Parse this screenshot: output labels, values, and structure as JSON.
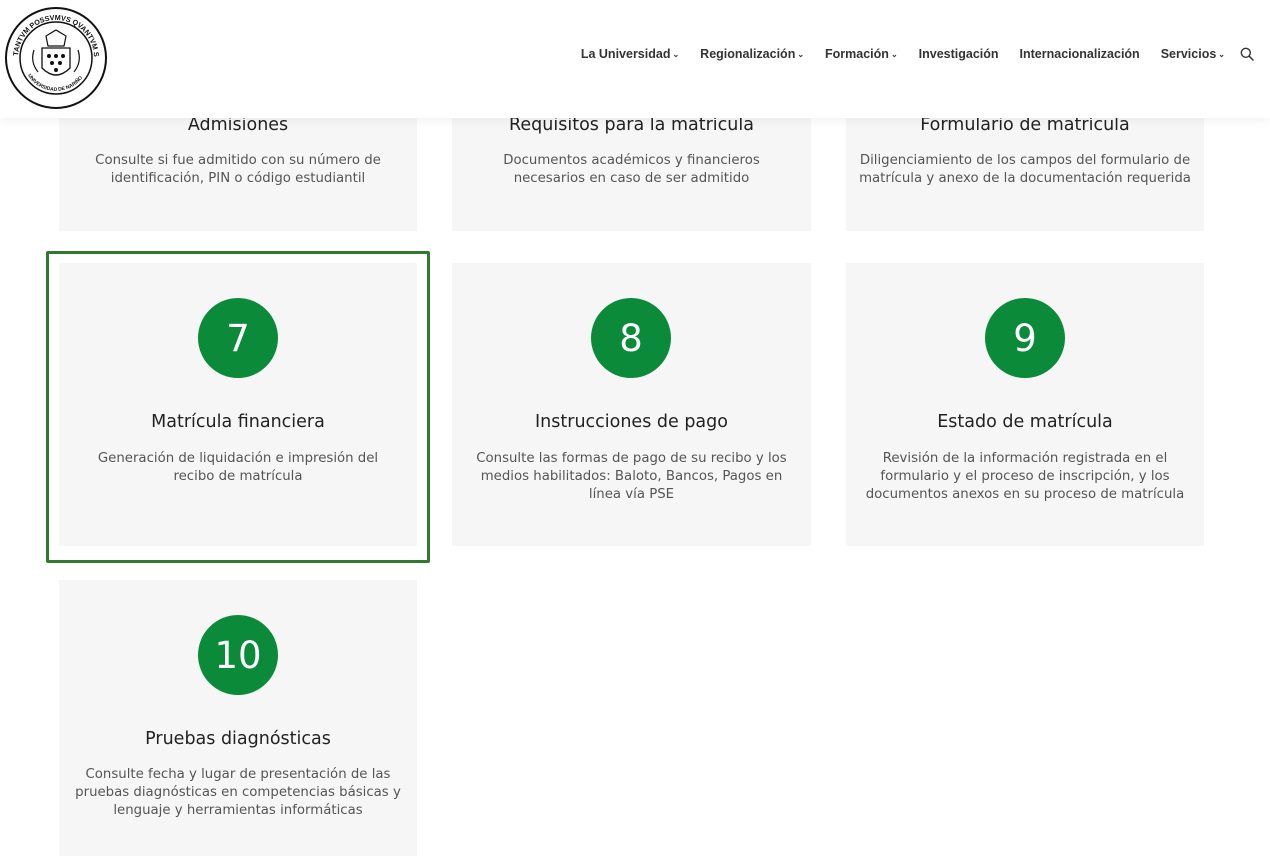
{
  "header": {
    "logo_text_top": "TANTVM POSSVMVS QVANTVM SCIMVS",
    "logo_text_bottom": "UNIVERSIDAD DE NARIÑO",
    "nav": [
      {
        "label": "La Universidad",
        "has_dropdown": true
      },
      {
        "label": "Regionalización",
        "has_dropdown": true
      },
      {
        "label": "Formación",
        "has_dropdown": true
      },
      {
        "label": "Investigación",
        "has_dropdown": false
      },
      {
        "label": "Internacionalización",
        "has_dropdown": false
      },
      {
        "label": "Servicios",
        "has_dropdown": true
      }
    ],
    "search_icon": "search-icon"
  },
  "cards": {
    "admisiones": {
      "title": "Admisiones",
      "desc": "Consulte si fue admitido con su número de identificación, PIN o código estudiantil"
    },
    "requisitos": {
      "title": "Requisitos para la matrícula",
      "desc": "Documentos académicos y financieros necesarios en caso de ser admitido"
    },
    "formulario": {
      "title": "Formulario de matrícula",
      "desc": "Diligenciamiento de los campos del formulario de matrícula y anexo de la documentación requerida"
    },
    "financiera": {
      "number": "7",
      "title": "Matrícula financiera",
      "desc": "Generación de liquidación e impresión del recibo de matrícula"
    },
    "pago": {
      "number": "8",
      "title": "Instrucciones de pago",
      "desc": "Consulte las formas de pago de su recibo y los medios habilitados: Baloto, Bancos, Pagos en línea vía PSE"
    },
    "estado": {
      "number": "9",
      "title": "Estado de matrícula",
      "desc": "Revisión de la información registrada en el formulario y el proceso de inscripción, y los documentos anexos en su proceso de matrícula"
    },
    "pruebas": {
      "number": "10",
      "title": "Pruebas diagnósticas",
      "desc": "Consulte fecha y lugar de presentación de las pruebas diagnósticas en competencias básicas y lenguaje y herramientas informáticas"
    }
  },
  "colors": {
    "accent_green": "#0b8b3a",
    "highlight_border": "#2f7a2f",
    "card_bg": "#f6f6f6"
  }
}
